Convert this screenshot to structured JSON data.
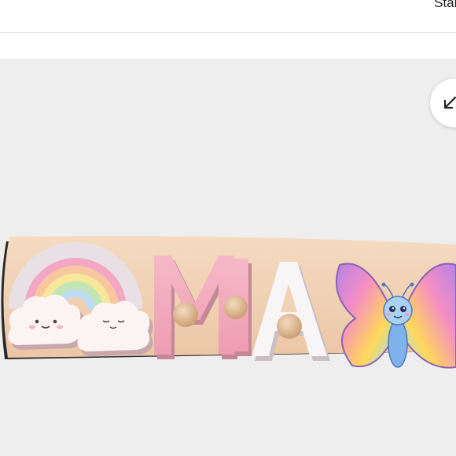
{
  "header": {
    "start_label": "Start"
  },
  "viewer": {
    "collapse_icon": "arrow-down-left-icon",
    "photo": {
      "puzzle_letters": [
        "M",
        "I",
        "A"
      ],
      "colors": {
        "background": "#eeeeee",
        "board": "#f1d2b4",
        "pink_letters": "#f2a9bd",
        "white_letter": "#f7f3f4",
        "knob": "#dcb389"
      }
    }
  }
}
